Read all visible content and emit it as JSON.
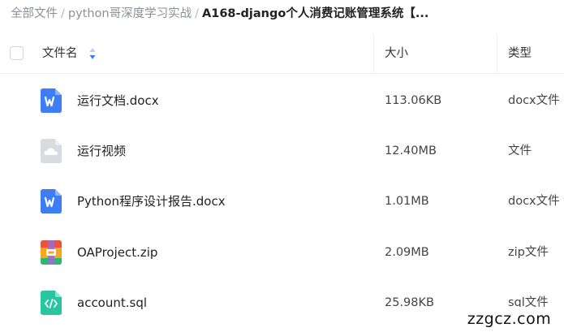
{
  "breadcrumb": {
    "items": [
      "全部文件",
      "python哥深度学习实战",
      "A168-django个人消费记账管理系统【..."
    ],
    "separator": "/"
  },
  "table": {
    "headers": {
      "name": "文件名",
      "size": "大小",
      "type": "类型"
    },
    "sort_icon": "sort-arrows-icon",
    "rows": [
      {
        "name": "运行文档.docx",
        "size": "113.06KB",
        "type": "docx文件",
        "icon": "word-doc-icon"
      },
      {
        "name": "运行视频",
        "size": "12.40MB",
        "type": "文件",
        "icon": "cloud-file-icon"
      },
      {
        "name": "Python程序设计报告.docx",
        "size": "1.01MB",
        "type": "docx文件",
        "icon": "word-doc-icon"
      },
      {
        "name": "OAProject.zip",
        "size": "2.09MB",
        "type": "zip文件",
        "icon": "zip-archive-icon"
      },
      {
        "name": "account.sql",
        "size": "25.98KB",
        "type": "sql文件",
        "icon": "code-file-icon"
      }
    ]
  },
  "watermark": "zzgcz.com",
  "colors": {
    "word_blue": "#3d7df5",
    "cloud_gray": "#d9dbe0",
    "zip_orange": "#f5a623",
    "code_green": "#26c6a0",
    "sort_blue": "#3a7cf0"
  }
}
